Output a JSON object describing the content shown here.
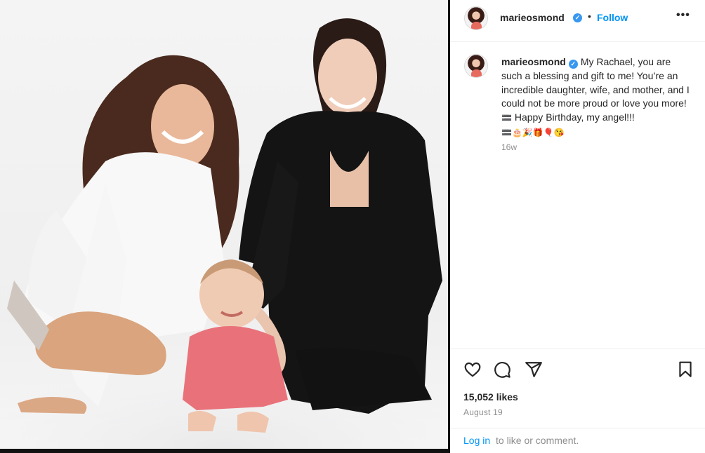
{
  "post": {
    "username": "marieosmond",
    "verified": true,
    "follow_label": "Follow",
    "separator": "•",
    "more_label": "•••",
    "caption": {
      "text_before_emojis": "My Rachael, you are such a blessing and gift to me! You’re an incredible daughter, wife, and mother, and I could not be more proud or love you more!",
      "emoji_1": "🟰",
      "text_mid": " Happy Birthday, my angel!!!",
      "emoji_tail": "🟰🎂🎉🎁🎈😘",
      "age": "16w"
    },
    "likes": "15,052 likes",
    "date": "August 19",
    "login_link": "Log in",
    "login_rest": "to like or comment."
  },
  "icons": {
    "avatar": "avatar",
    "verified": "verified-badge-icon",
    "like": "heart-icon",
    "comment": "comment-icon",
    "share": "share-icon",
    "save": "bookmark-icon"
  },
  "colors": {
    "link": "#0095f6",
    "verified": "#3897f0",
    "muted": "#8e8e8e",
    "text": "#262626"
  }
}
